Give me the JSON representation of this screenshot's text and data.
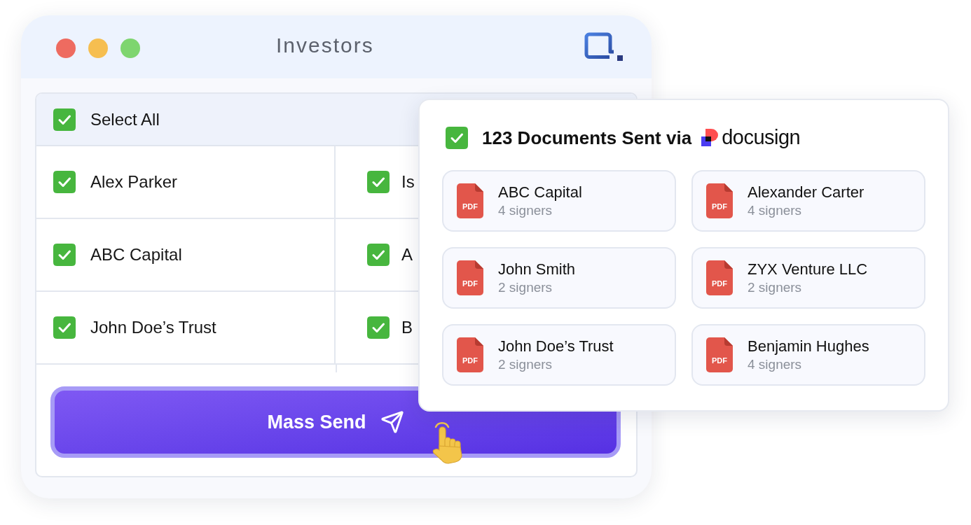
{
  "window": {
    "title": "Investors"
  },
  "select_all": {
    "label": "Select All",
    "checked": true
  },
  "investors": [
    {
      "name": "Alex Parker",
      "checked": true
    },
    {
      "name": "Is",
      "checked": true
    },
    {
      "name": "ABC Capital",
      "checked": true
    },
    {
      "name": "A",
      "checked": true
    },
    {
      "name": "John Doe’s Trust",
      "checked": true
    },
    {
      "name": "B",
      "checked": true
    }
  ],
  "mass_send_button": {
    "label": "Mass Send"
  },
  "sent_panel": {
    "checked": true,
    "title": "123 Documents Sent via",
    "brand": "docusign",
    "documents": [
      {
        "name": "ABC Capital",
        "signers": "4 signers",
        "file_type": "PDF"
      },
      {
        "name": "Alexander Carter",
        "signers": "4 signers",
        "file_type": "PDF"
      },
      {
        "name": "John Smith",
        "signers": "2 signers",
        "file_type": "PDF"
      },
      {
        "name": "ZYX Venture LLC",
        "signers": "2 signers",
        "file_type": "PDF"
      },
      {
        "name": "John Doe’s Trust",
        "signers": "2 signers",
        "file_type": "PDF"
      },
      {
        "name": "Benjamin Hughes",
        "signers": "4 signers",
        "file_type": "PDF"
      }
    ]
  }
}
